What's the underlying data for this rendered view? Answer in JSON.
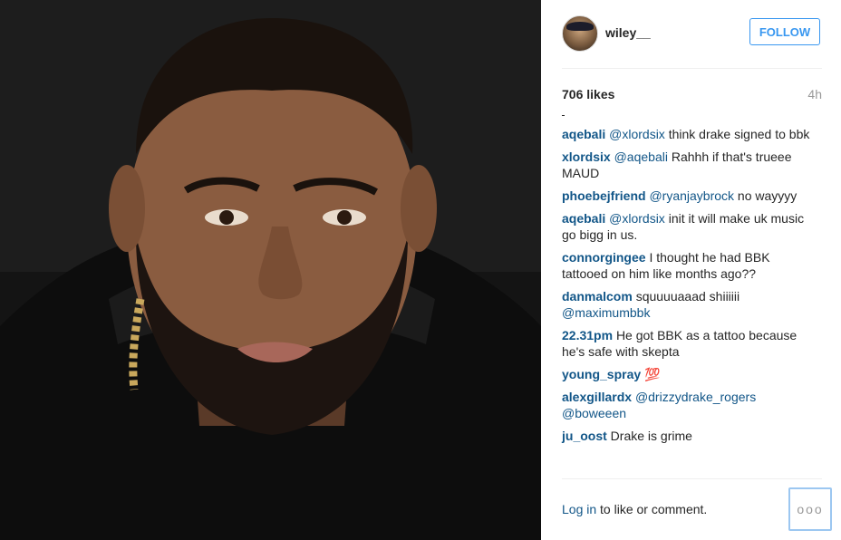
{
  "post": {
    "photo_alt": "Portrait of a man with a beard wearing a black hoodie and a gold chain",
    "username": "wiley__",
    "follow_label": "FOLLOW",
    "likes": "706 likes",
    "time_ago": "4h",
    "comments": [
      {
        "user": "aqebali",
        "mention": "@xlordsix",
        "text": " think drake signed to bbk"
      },
      {
        "user": "xlordsix",
        "mention": "@aqebali",
        "text": " Rahhh if that's trueee MAUD"
      },
      {
        "user": "phoebejfriend",
        "mention": "@ryanjaybrock",
        "text": " no wayyyy"
      },
      {
        "user": "aqebali",
        "mention": "@xlordsix",
        "text": " init it will make uk music go bigg in us."
      },
      {
        "user": "connorgingee",
        "mention": "",
        "text": "I thought he had BBK tattooed on him like months ago??"
      },
      {
        "user": "danmalcom",
        "mention": "",
        "text": "squuuuaaad shiiiiii",
        "mention2": "@maximumbbk"
      },
      {
        "user": "22.31pm",
        "mention": "",
        "text": "He got BBK as a tattoo because he's safe with skepta"
      },
      {
        "user": "young_spray",
        "mention": "",
        "text": "💯"
      },
      {
        "user": "alexgillardx",
        "mention": "@drizzydrake_rogers",
        "text": "",
        "mention2": "@boweeen"
      },
      {
        "user": "ju_oost",
        "mention": "",
        "text": "Drake is grime"
      }
    ],
    "login_link": "Log in",
    "login_text": " to like or comment.",
    "more_label": "ooo"
  },
  "colors": {
    "link": "#125688",
    "follow": "#3897f0",
    "muted": "#999999"
  },
  "icons": {
    "more": "more-options-icon"
  }
}
